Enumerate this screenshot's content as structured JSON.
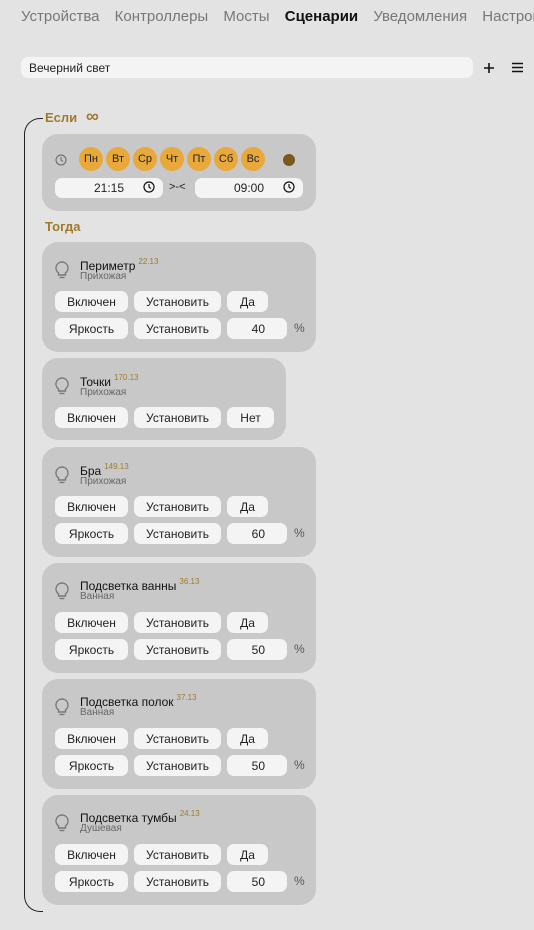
{
  "nav": {
    "tabs": [
      "Устройства",
      "Контроллеры",
      "Мосты",
      "Сценарии",
      "Уведомления",
      "Настройки"
    ],
    "active_index": 3
  },
  "scenario": {
    "name": "Вечерний свет",
    "add_icon": "plus-icon",
    "menu_icon": "menu-icon"
  },
  "condition": {
    "label": "Если",
    "repeat_symbol": "∞",
    "days": [
      "Пн",
      "Вт",
      "Ср",
      "Чт",
      "Пт",
      "Сб",
      "Вс"
    ],
    "time_from": "21:15",
    "time_separator": ">-<",
    "time_to": "09:00"
  },
  "actions_label": "Тогда",
  "actions": [
    {
      "device": "Периметр",
      "id": "22.13",
      "room": "Прихожая",
      "rows": [
        {
          "property": "Включен",
          "op": "Установить",
          "value": "Да"
        },
        {
          "property": "Яркость",
          "op": "Установить",
          "value": "40",
          "unit": "%"
        }
      ]
    },
    {
      "device": "Точки",
      "id": "170.13",
      "room": "Прихожая",
      "rows": [
        {
          "property": "Включен",
          "op": "Установить",
          "value": "Нет"
        }
      ]
    },
    {
      "device": "Бра",
      "id": "149.13",
      "room": "Прихожая",
      "rows": [
        {
          "property": "Включен",
          "op": "Установить",
          "value": "Да"
        },
        {
          "property": "Яркость",
          "op": "Установить",
          "value": "60",
          "unit": "%"
        }
      ]
    },
    {
      "device": "Подсветка ванны",
      "id": "36.13",
      "room": "Ванная",
      "rows": [
        {
          "property": "Включен",
          "op": "Установить",
          "value": "Да"
        },
        {
          "property": "Яркость",
          "op": "Установить",
          "value": "50",
          "unit": "%"
        }
      ]
    },
    {
      "device": "Подсветка полок",
      "id": "37.13",
      "room": "Ванная",
      "rows": [
        {
          "property": "Включен",
          "op": "Установить",
          "value": "Да"
        },
        {
          "property": "Яркость",
          "op": "Установить",
          "value": "50",
          "unit": "%"
        }
      ]
    },
    {
      "device": "Подсветка тумбы",
      "id": "24.13",
      "room": "Душевая",
      "rows": [
        {
          "property": "Включен",
          "op": "Установить",
          "value": "Да"
        },
        {
          "property": "Яркость",
          "op": "Установить",
          "value": "50",
          "unit": "%"
        }
      ]
    }
  ],
  "colors": {
    "accent": "#a07a2a",
    "day_chip": "#e8a83a",
    "status_dot": "#7a5a1c",
    "card": "#c8c8c8",
    "background": "#e3e3e3"
  }
}
